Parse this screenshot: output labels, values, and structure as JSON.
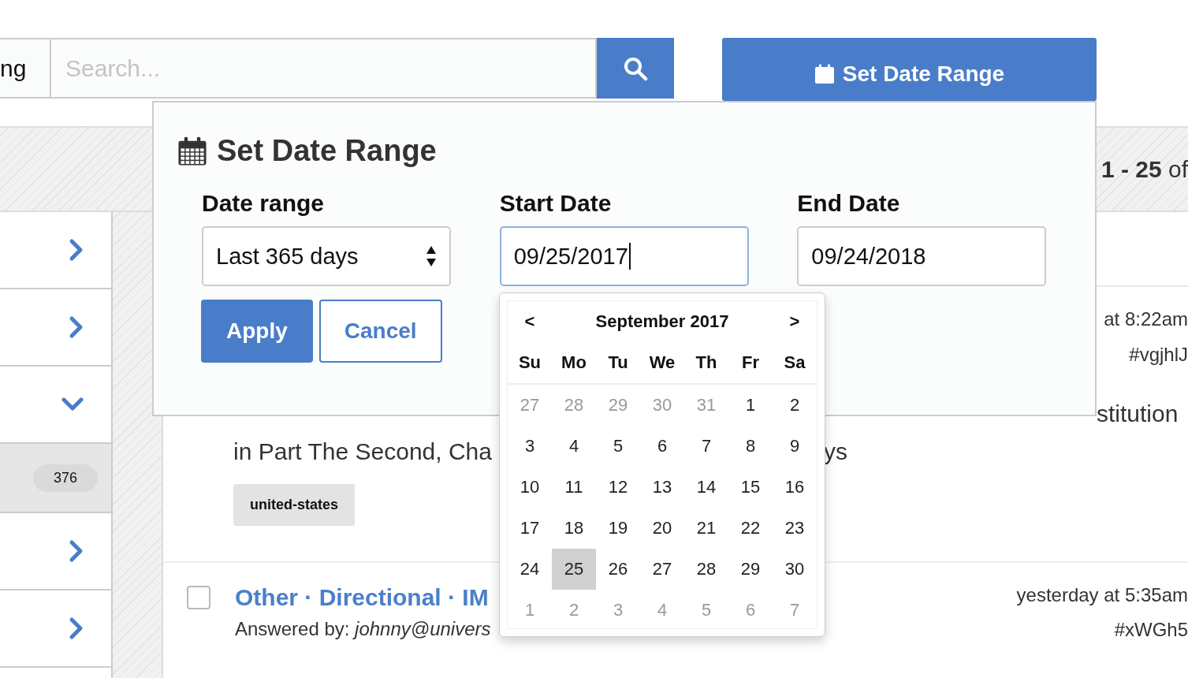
{
  "toolbar": {
    "filter_label": "ng",
    "search": {
      "placeholder": "Search..."
    },
    "date_button": "Set Date Range"
  },
  "results_header": {
    "range": "**1 - 25** of"
  },
  "sidebar": {
    "items": [
      {
        "kind": "chevron",
        "expanded": false,
        "selected": false
      },
      {
        "kind": "chevron",
        "expanded": false,
        "selected": false
      },
      {
        "kind": "chevron",
        "expanded": true,
        "selected": false
      },
      {
        "kind": "count",
        "count": "376",
        "selected": true
      },
      {
        "kind": "chevron",
        "expanded": false,
        "selected": false
      },
      {
        "kind": "chevron",
        "expanded": false,
        "selected": false
      }
    ]
  },
  "questions": [
    {
      "time": "at 8:22am",
      "id": "#vgjhlJ",
      "body_parts": [
        "stitution",
        "in Part The Second, Cha",
        "ys"
      ],
      "tag": "united-states"
    },
    {
      "checked": false,
      "title": "Other · Directional · IM",
      "answered_by": "Answered by: *johnny@univers*",
      "time": "yesterday at 5:35am",
      "id": "#xWGh5"
    }
  ],
  "date_dialog": {
    "title": "Set Date Range",
    "fields": [
      {
        "label": "Date range",
        "kind": "select",
        "value": "Last 365 days",
        "focused": false
      },
      {
        "label": "Start Date",
        "kind": "date",
        "value": "09/25/2017",
        "focused": true
      },
      {
        "label": "End Date",
        "kind": "date",
        "value": "09/24/2018",
        "focused": false
      }
    ],
    "buttons": [
      {
        "label": "Apply",
        "primary": true
      },
      {
        "label": "Cancel",
        "primary": false
      }
    ]
  },
  "calendar": {
    "prev": "<",
    "month": "September 2017",
    "next": ">",
    "weekdays": [
      "Su",
      "Mo",
      "Tu",
      "We",
      "Th",
      "Fr",
      "Sa"
    ],
    "weeks": [
      [
        {
          "day": "27",
          "other_month": true,
          "selected": false
        },
        {
          "day": "28",
          "other_month": true,
          "selected": false
        },
        {
          "day": "29",
          "other_month": true,
          "selected": false
        },
        {
          "day": "30",
          "other_month": true,
          "selected": false
        },
        {
          "day": "31",
          "other_month": true,
          "selected": false
        },
        {
          "day": "1",
          "other_month": false,
          "selected": false
        },
        {
          "day": "2",
          "other_month": false,
          "selected": false
        }
      ],
      [
        {
          "day": "3",
          "other_month": false,
          "selected": false
        },
        {
          "day": "4",
          "other_month": false,
          "selected": false
        },
        {
          "day": "5",
          "other_month": false,
          "selected": false
        },
        {
          "day": "6",
          "other_month": false,
          "selected": false
        },
        {
          "day": "7",
          "other_month": false,
          "selected": false
        },
        {
          "day": "8",
          "other_month": false,
          "selected": false
        },
        {
          "day": "9",
          "other_month": false,
          "selected": false
        }
      ],
      [
        {
          "day": "10",
          "other_month": false,
          "selected": false
        },
        {
          "day": "11",
          "other_month": false,
          "selected": false
        },
        {
          "day": "12",
          "other_month": false,
          "selected": false
        },
        {
          "day": "13",
          "other_month": false,
          "selected": false
        },
        {
          "day": "14",
          "other_month": false,
          "selected": false
        },
        {
          "day": "15",
          "other_month": false,
          "selected": false
        },
        {
          "day": "16",
          "other_month": false,
          "selected": false
        }
      ],
      [
        {
          "day": "17",
          "other_month": false,
          "selected": false
        },
        {
          "day": "18",
          "other_month": false,
          "selected": false
        },
        {
          "day": "19",
          "other_month": false,
          "selected": false
        },
        {
          "day": "20",
          "other_month": false,
          "selected": false
        },
        {
          "day": "21",
          "other_month": false,
          "selected": false
        },
        {
          "day": "22",
          "other_month": false,
          "selected": false
        },
        {
          "day": "23",
          "other_month": false,
          "selected": false
        }
      ],
      [
        {
          "day": "24",
          "other_month": false,
          "selected": false
        },
        {
          "day": "25",
          "other_month": false,
          "selected": true
        },
        {
          "day": "26",
          "other_month": false,
          "selected": false
        },
        {
          "day": "27",
          "other_month": false,
          "selected": false
        },
        {
          "day": "28",
          "other_month": false,
          "selected": false
        },
        {
          "day": "29",
          "other_month": false,
          "selected": false
        },
        {
          "day": "30",
          "other_month": false,
          "selected": false
        }
      ],
      [
        {
          "day": "1",
          "other_month": true,
          "selected": false
        },
        {
          "day": "2",
          "other_month": true,
          "selected": false
        },
        {
          "day": "3",
          "other_month": true,
          "selected": false
        },
        {
          "day": "4",
          "other_month": true,
          "selected": false
        },
        {
          "day": "5",
          "other_month": true,
          "selected": false
        },
        {
          "day": "6",
          "other_month": true,
          "selected": false
        },
        {
          "day": "7",
          "other_month": true,
          "selected": false
        }
      ]
    ]
  }
}
